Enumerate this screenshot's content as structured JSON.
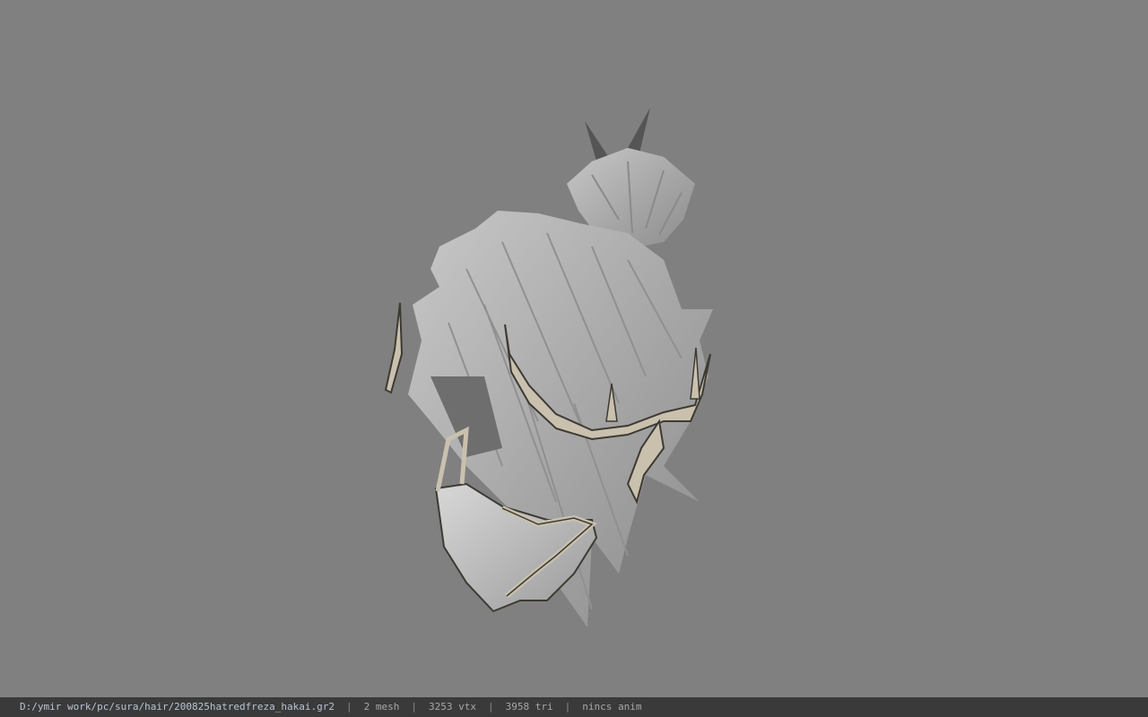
{
  "viewer": {
    "background_color": "#808080"
  },
  "model": {
    "icon": "hair-model-icon",
    "hair_color": "#b0b0b0",
    "ornament_color": "#c9c1ae"
  },
  "status_bar": {
    "file_path": "D:/ymir work/pc/sura/hair/200825hatredfreza_hakai.gr2",
    "separator": "|",
    "mesh_count": "2 mesh",
    "vertex_count": "3253 vtx",
    "triangle_count": "3958 tri",
    "anim_status": "nincs anim"
  }
}
